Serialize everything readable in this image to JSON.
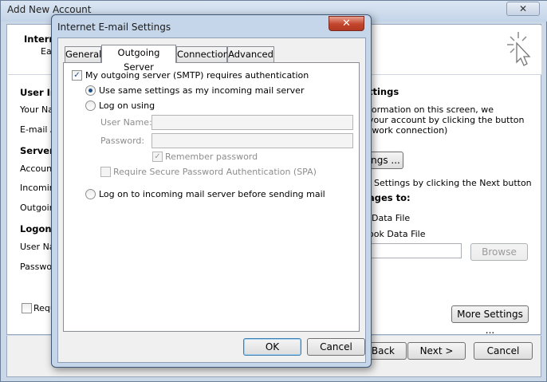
{
  "background_window": {
    "title": "Add New Account",
    "close_glyph": "✕",
    "header_title": "Intern",
    "header_subtitle": "Ea",
    "user_info_heading": "User In",
    "your_name_label": "Your Na",
    "email_label": "E-mail A",
    "server_info_heading": "Server I",
    "account_type_label": "Account",
    "incoming_label": "Incoming",
    "outgoing_label": "Outgoin",
    "logon_info_heading": "Logon I",
    "user_name_label": "User Na",
    "password_label": "Passwo",
    "require_label": "Requ",
    "settings_heading": "ttings",
    "info_line1": "formation on this screen, we",
    "info_line2": "your account by clicking the button",
    "info_line3": "twork connection)",
    "test_button": "ngs ...",
    "next_hint": "Settings by clicking the Next button",
    "deliver_heading": "ages to:",
    "data_file_option1": "Data File",
    "data_file_option2": "ook Data File",
    "browse_button": "Browse",
    "more_settings_button": "More Settings ...",
    "back_button": "Back",
    "next_button": "Next >",
    "cancel_button": "Cancel"
  },
  "dialog": {
    "title": "Internet E-mail Settings",
    "close_glyph": "✕",
    "tabs": [
      {
        "label": "General"
      },
      {
        "label": "Outgoing Server"
      },
      {
        "label": "Connection"
      },
      {
        "label": "Advanced"
      }
    ],
    "smtp_auth_label": "My outgoing server (SMTP) requires authentication",
    "smtp_auth_checked": true,
    "use_same_settings_label": "Use same settings as my incoming mail server",
    "log_on_using_label": "Log on using",
    "user_name_label": "User Name:",
    "user_name_value": "",
    "password_label": "Password:",
    "password_value": "",
    "remember_password_label": "Remember password",
    "spa_label": "Require Secure Password Authentication (SPA)",
    "log_on_incoming_label": "Log on to incoming mail server before sending mail",
    "ok_button": "OK",
    "cancel_button": "Cancel",
    "check_glyph": "✓"
  }
}
